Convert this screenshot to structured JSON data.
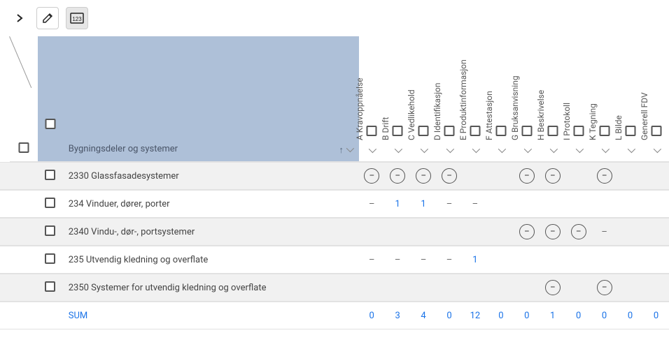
{
  "toolbar": {
    "expand": true,
    "edit": true,
    "numbers_active": true
  },
  "header": {
    "name_column": "Bygningsdeler og systemer",
    "columns": [
      {
        "key": "A",
        "label": "A Kravoppnåelse"
      },
      {
        "key": "B",
        "label": "B Drift"
      },
      {
        "key": "C",
        "label": "C Vedlikehold"
      },
      {
        "key": "D",
        "label": "D Identifikasjon"
      },
      {
        "key": "E",
        "label": "E Produktinformasjon"
      },
      {
        "key": "F",
        "label": "F Attestasjon"
      },
      {
        "key": "G",
        "label": "G Bruksanvisning"
      },
      {
        "key": "H",
        "label": "H Beskrivelse"
      },
      {
        "key": "I",
        "label": "I Protokoll"
      },
      {
        "key": "K",
        "label": "K Tegning"
      },
      {
        "key": "L",
        "label": "L Bilde"
      },
      {
        "key": "GEN",
        "label": "Generell FDV"
      }
    ]
  },
  "rows": [
    {
      "name": "2330 Glassfasadesystemer",
      "alt": true,
      "cells": [
        "circ",
        "circ",
        "circ",
        "circ",
        "",
        "",
        "circ",
        "circ",
        "",
        "circ",
        "",
        ""
      ]
    },
    {
      "name": "234 Vinduer, dører, porter",
      "alt": false,
      "cells": [
        "dash",
        "link:1",
        "link:1",
        "dash",
        "dash",
        "",
        "",
        "",
        "",
        "",
        "",
        ""
      ]
    },
    {
      "name": "2340 Vindu-, dør-, portsystemer",
      "alt": true,
      "cells": [
        "",
        "",
        "",
        "",
        "",
        "",
        "circ",
        "circ",
        "circ",
        "dash",
        "",
        ""
      ]
    },
    {
      "name": "235 Utvendig kledning og overflate",
      "alt": false,
      "cells": [
        "dash",
        "dash",
        "dash",
        "dash",
        "link:1",
        "",
        "",
        "",
        "",
        "",
        "",
        ""
      ]
    },
    {
      "name": "2350 Systemer for utvendig kledning og overflate",
      "alt": true,
      "cells": [
        "",
        "",
        "",
        "",
        "",
        "",
        "",
        "circ",
        "",
        "circ",
        "",
        ""
      ]
    }
  ],
  "sum": {
    "label": "SUM",
    "values": [
      "0",
      "3",
      "4",
      "0",
      "12",
      "0",
      "0",
      "1",
      "0",
      "0",
      "0",
      "0"
    ]
  }
}
